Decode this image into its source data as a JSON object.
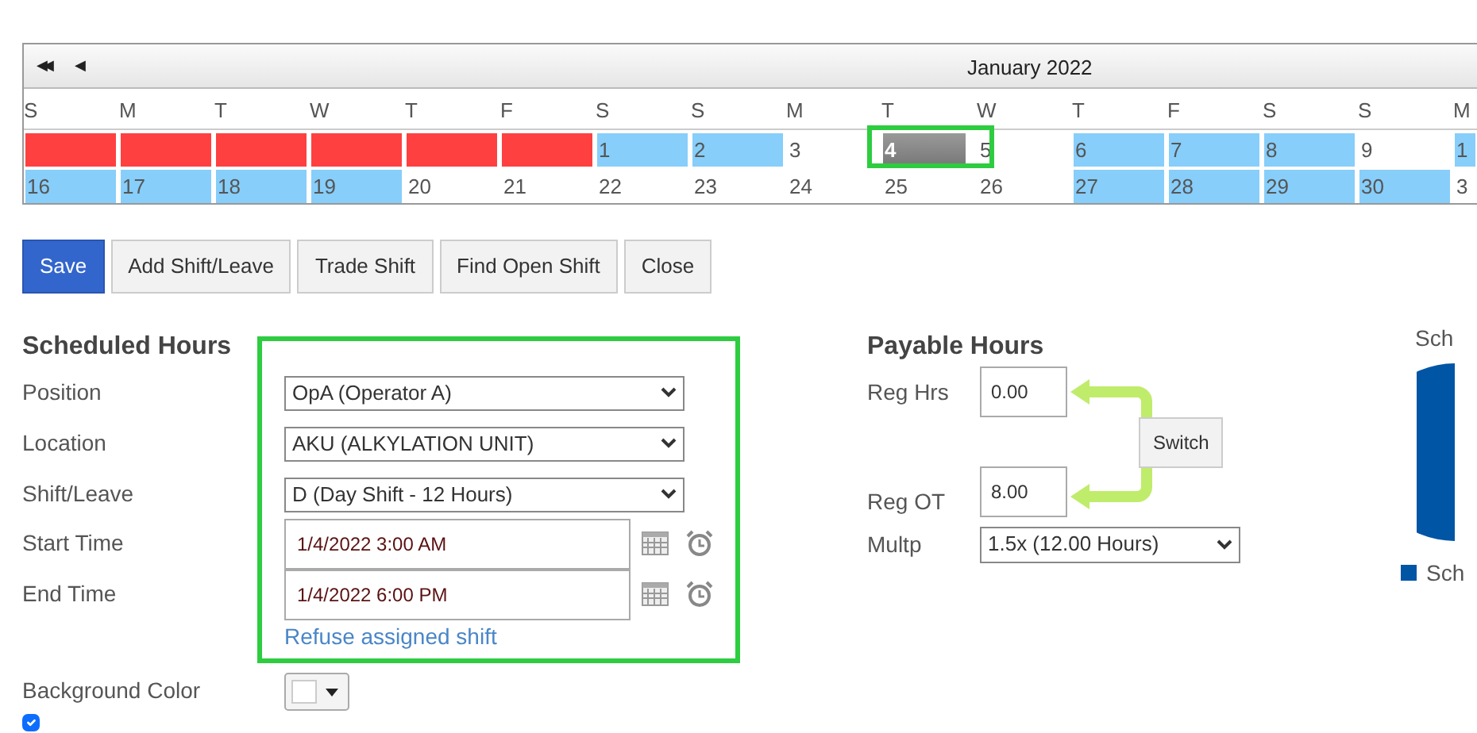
{
  "calendar": {
    "nav_buttons": [
      {
        "label": "◀◀"
      },
      {
        "label": "◀"
      }
    ],
    "title": "January 2022",
    "weekdays": [
      "S",
      "M",
      "T",
      "W",
      "T",
      "F",
      "S",
      "S",
      "M",
      "T",
      "W",
      "T",
      "F",
      "S",
      "S",
      "M"
    ],
    "weeks": [
      [
        {
          "kind": "blocked"
        },
        {
          "kind": "blocked"
        },
        {
          "kind": "blocked"
        },
        {
          "kind": "blocked"
        },
        {
          "kind": "blocked"
        },
        {
          "kind": "blocked"
        },
        {
          "kind": "day",
          "day": "1",
          "scheduled": true,
          "selected": false
        },
        {
          "kind": "day",
          "day": "2",
          "scheduled": true,
          "selected": false
        },
        {
          "kind": "day",
          "day": "3",
          "scheduled": false,
          "selected": false
        },
        {
          "kind": "day",
          "day": "4",
          "scheduled": false,
          "selected": true
        },
        {
          "kind": "day",
          "day": "5",
          "scheduled": false,
          "selected": false
        },
        {
          "kind": "day",
          "day": "6",
          "scheduled": true,
          "selected": false
        },
        {
          "kind": "day",
          "day": "7",
          "scheduled": true,
          "selected": false
        },
        {
          "kind": "day",
          "day": "8",
          "scheduled": true,
          "selected": false
        },
        {
          "kind": "day",
          "day": "9",
          "scheduled": false,
          "selected": false
        },
        {
          "kind": "day",
          "day": "1",
          "scheduled": true,
          "selected": false
        }
      ],
      [
        {
          "kind": "day",
          "day": "16",
          "scheduled": true,
          "selected": false
        },
        {
          "kind": "day",
          "day": "17",
          "scheduled": true,
          "selected": false
        },
        {
          "kind": "day",
          "day": "18",
          "scheduled": true,
          "selected": false
        },
        {
          "kind": "day",
          "day": "19",
          "scheduled": true,
          "selected": false
        },
        {
          "kind": "day",
          "day": "20",
          "scheduled": false,
          "selected": false
        },
        {
          "kind": "day",
          "day": "21",
          "scheduled": false,
          "selected": false
        },
        {
          "kind": "day",
          "day": "22",
          "scheduled": false,
          "selected": false
        },
        {
          "kind": "day",
          "day": "23",
          "scheduled": false,
          "selected": false
        },
        {
          "kind": "day",
          "day": "24",
          "scheduled": false,
          "selected": false
        },
        {
          "kind": "day",
          "day": "25",
          "scheduled": false,
          "selected": false
        },
        {
          "kind": "day",
          "day": "26",
          "scheduled": false,
          "selected": false
        },
        {
          "kind": "day",
          "day": "27",
          "scheduled": true,
          "selected": false
        },
        {
          "kind": "day",
          "day": "28",
          "scheduled": true,
          "selected": false
        },
        {
          "kind": "day",
          "day": "29",
          "scheduled": true,
          "selected": false
        },
        {
          "kind": "day",
          "day": "30",
          "scheduled": true,
          "selected": false
        },
        {
          "kind": "day",
          "day": "3",
          "scheduled": false,
          "selected": false
        }
      ]
    ]
  },
  "actions": [
    {
      "label": "Save",
      "primary": true
    },
    {
      "label": "Add Shift/Leave",
      "primary": false
    },
    {
      "label": "Trade Shift",
      "primary": false
    },
    {
      "label": "Find Open Shift",
      "primary": false
    },
    {
      "label": "Close",
      "primary": false
    }
  ],
  "scheduled_hours": {
    "title": "Scheduled Hours",
    "fields": [
      {
        "kind": "select",
        "label": "Position",
        "value": "OpA (Operator A)"
      },
      {
        "kind": "select",
        "label": "Location",
        "value": "AKU (ALKYLATION UNIT)"
      },
      {
        "kind": "select",
        "label": "Shift/Leave",
        "value": "D (Day Shift - 12 Hours)"
      },
      {
        "kind": "datetime",
        "label": "Start Time",
        "value": "1/4/2022 3:00 AM"
      },
      {
        "kind": "datetime",
        "label": "End Time",
        "value": "1/4/2022 6:00 PM"
      }
    ],
    "link": "Refuse assigned shift",
    "background_color_label": "Background Color",
    "notify_checked": true
  },
  "payable_hours": {
    "title": "Payable Hours",
    "reg_hrs_label": "Reg Hrs",
    "reg_hrs": "0.00",
    "switch": "Switch",
    "reg_ot_label": "Reg OT",
    "reg_ot": "8.00",
    "multp_label": "Multp",
    "multp": "1.5x (12.00 Hours)"
  },
  "chart": {
    "title": "Sch",
    "legend": "Sch"
  }
}
